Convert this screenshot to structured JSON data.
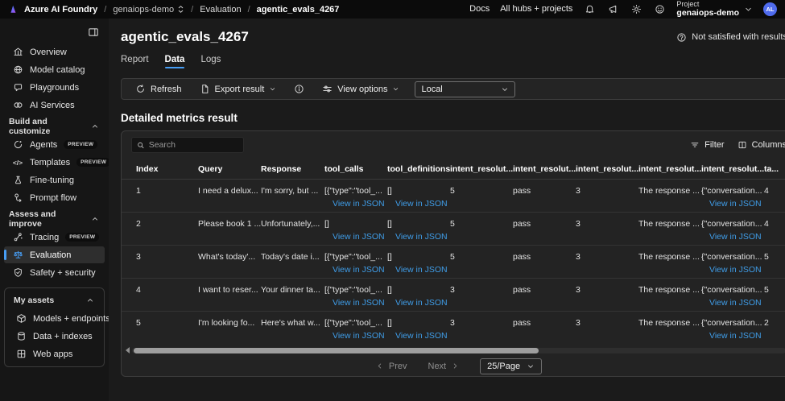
{
  "topbar": {
    "brand": "Azure AI Foundry",
    "crumb_project": "genaiops-demo",
    "crumb_section": "Evaluation",
    "crumb_page": "agentic_evals_4267",
    "docs": "Docs",
    "all_hubs": "All hubs + projects",
    "project_label": "Project",
    "project_name": "genaiops-demo",
    "avatar_initials": "AL"
  },
  "sidebar": {
    "sections": [
      {
        "items": [
          {
            "label": "Overview"
          },
          {
            "label": "Model catalog"
          },
          {
            "label": "Playgrounds"
          },
          {
            "label": "AI Services"
          }
        ]
      },
      {
        "header": "Build and customize",
        "items": [
          {
            "label": "Agents",
            "badge": "PREVIEW"
          },
          {
            "label": "Templates",
            "badge": "PREVIEW"
          },
          {
            "label": "Fine-tuning"
          },
          {
            "label": "Prompt flow"
          }
        ]
      },
      {
        "header": "Assess and improve",
        "items": [
          {
            "label": "Tracing",
            "badge": "PREVIEW"
          },
          {
            "label": "Evaluation",
            "selected": true
          },
          {
            "label": "Safety + security"
          }
        ]
      },
      {
        "header": "My assets",
        "items": [
          {
            "label": "Models + endpoints"
          },
          {
            "label": "Data + indexes"
          },
          {
            "label": "Web apps"
          }
        ]
      }
    ]
  },
  "page": {
    "title": "agentic_evals_4267",
    "tabs": [
      "Report",
      "Data",
      "Logs"
    ],
    "active_tab": "Data",
    "feedback_link": "Not satisfied with results?"
  },
  "toolbar": {
    "refresh": "Refresh",
    "export": "Export result",
    "view_options": "View options",
    "dataset_select": "Local"
  },
  "metrics": {
    "heading": "Detailed metrics result",
    "search_placeholder": "Search",
    "filter": "Filter",
    "columns": "Columns"
  },
  "table": {
    "view_in_json": "View in JSON",
    "headers": [
      "Index",
      "Query",
      "Response",
      "tool_calls",
      "tool_definitions",
      "intent_resolut...",
      "intent_resolut...",
      "intent_resolut...",
      "intent_resolut...",
      "intent_resolut...",
      "ta..."
    ],
    "rows": [
      {
        "index": "1",
        "query": "I need a delux...",
        "response": "I'm sorry, but ...",
        "tool_calls": "[{\"type\":\"tool_...",
        "tool_definitions": "[]",
        "ir1": "5",
        "ir2": "pass",
        "ir3": "3",
        "ir4": "The response ...",
        "ir5": "{\"conversation...",
        "ta": "4"
      },
      {
        "index": "2",
        "query": "Please book 1 ...",
        "response": "Unfortunately,...",
        "tool_calls": "[]",
        "tool_definitions": "[]",
        "ir1": "5",
        "ir2": "pass",
        "ir3": "3",
        "ir4": "The response ...",
        "ir5": "{\"conversation...",
        "ta": "4"
      },
      {
        "index": "3",
        "query": "What's today'...",
        "response": "Today's date i...",
        "tool_calls": "[{\"type\":\"tool_...",
        "tool_definitions": "[]",
        "ir1": "5",
        "ir2": "pass",
        "ir3": "3",
        "ir4": "The response ...",
        "ir5": "{\"conversation...",
        "ta": "5"
      },
      {
        "index": "4",
        "query": "I want to reser...",
        "response": "Your dinner ta...",
        "tool_calls": "[{\"type\":\"tool_...",
        "tool_definitions": "[]",
        "ir1": "3",
        "ir2": "pass",
        "ir3": "3",
        "ir4": "The response ...",
        "ir5": "{\"conversation...",
        "ta": "5"
      },
      {
        "index": "5",
        "query": "I'm looking fo...",
        "response": "Here's what w...",
        "tool_calls": "[{\"type\":\"tool_...",
        "tool_definitions": "[]",
        "ir1": "3",
        "ir2": "pass",
        "ir3": "3",
        "ir4": "The response ...",
        "ir5": "{\"conversation...",
        "ta": "2"
      }
    ]
  },
  "pagination": {
    "prev": "Prev",
    "next": "Next",
    "page_size": "25/Page"
  },
  "colors": {
    "accent": "#479ef5",
    "link": "#3f9de8",
    "avatar": "#4f6bed"
  }
}
